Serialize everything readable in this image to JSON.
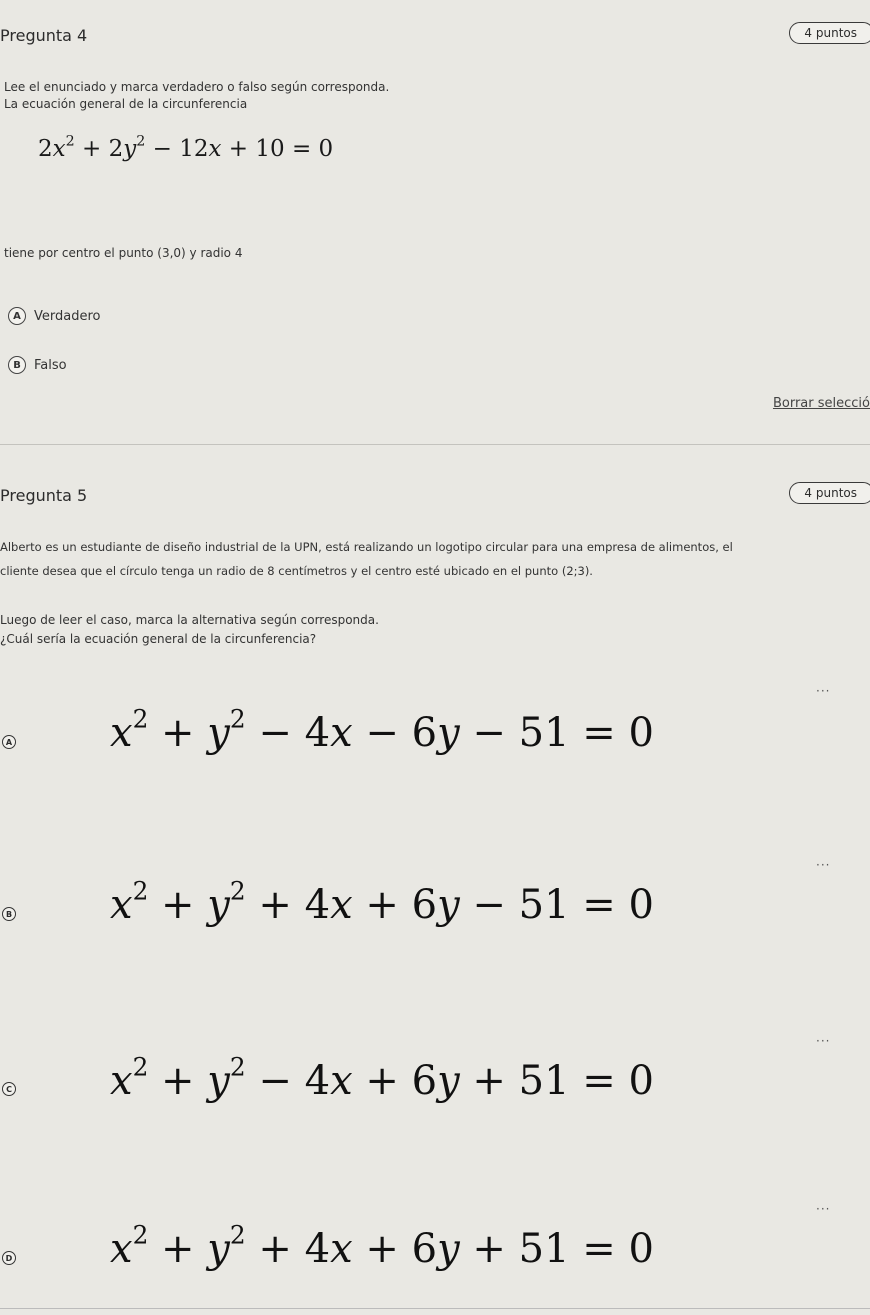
{
  "q4": {
    "title": "Pregunta 4",
    "points": "4 puntos",
    "instruction": "Lee el enunciado y marca verdadero o falso según corresponda.",
    "statement_intro": "La ecuación general de la circunferencia",
    "equation": {
      "a": "2",
      "b": "2",
      "rest": " − 12",
      "tail": " + 10 = 0"
    },
    "statement_end": "tiene por centro el punto (3,0) y radio 4",
    "options": [
      {
        "letter": "A",
        "label": "Verdadero"
      },
      {
        "letter": "B",
        "label": "Falso"
      }
    ],
    "clear_link": "Borrar selecció"
  },
  "q5": {
    "title": "Pregunta 5",
    "points": "4 puntos",
    "paragraph_line1": "Alberto es un estudiante de diseño industrial de la UPN, está realizando un logotipo circular para una empresa de alimentos, el",
    "paragraph_line2": "cliente desea que el círculo tenga un radio de 8 centímetros y el centro esté ubicado en el punto (2;3).",
    "instruction": "Luego de leer el caso, marca la alternativa según corresponda.",
    "question": "¿Cuál sería la ecuación general de la circunferencia?",
    "options": [
      {
        "letter": "A",
        "sx": " − 4",
        "sy": " − 6",
        "c": " − 51 = 0"
      },
      {
        "letter": "B",
        "sx": " + 4",
        "sy": " + 6",
        "c": " − 51 = 0"
      },
      {
        "letter": "C",
        "sx": " − 4",
        "sy": " + 6",
        "c": " + 51 = 0"
      },
      {
        "letter": "D",
        "sx": " + 4",
        "sy": " + 6",
        "c": " + 51 = 0"
      }
    ],
    "more_icon": "more-options-icon"
  }
}
